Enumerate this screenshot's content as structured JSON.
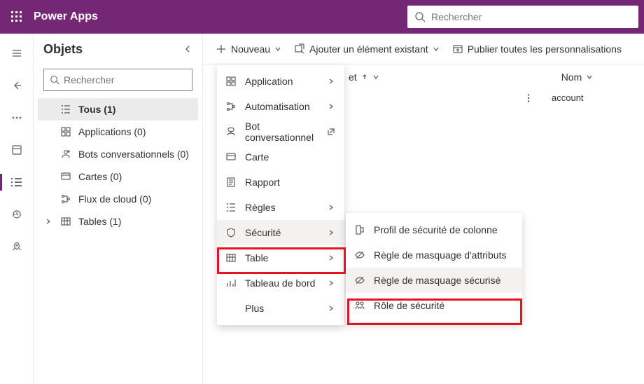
{
  "header": {
    "appTitle": "Power Apps",
    "searchPlaceholder": "Rechercher"
  },
  "sidePanel": {
    "title": "Objets",
    "searchPlaceholder": "Rechercher",
    "items": [
      {
        "label": "Tous  (1)",
        "selected": true,
        "expandable": false
      },
      {
        "label": "Applications  (0)",
        "selected": false,
        "expandable": false
      },
      {
        "label": "Bots conversationnels  (0)",
        "selected": false,
        "expandable": false
      },
      {
        "label": "Cartes  (0)",
        "selected": false,
        "expandable": false
      },
      {
        "label": "Flux de cloud  (0)",
        "selected": false,
        "expandable": false
      },
      {
        "label": "Tables  (1)",
        "selected": false,
        "expandable": true
      }
    ]
  },
  "cmdbar": {
    "new": "Nouveau",
    "addExisting": "Ajouter un élément existant",
    "publish": "Publier toutes les personnalisations"
  },
  "columns": {
    "displayName": "et",
    "name": "Nom"
  },
  "row": {
    "name": "account"
  },
  "newMenu": {
    "items": [
      {
        "label": "Application",
        "hasSub": true
      },
      {
        "label": "Automatisation",
        "hasSub": true
      },
      {
        "label": "Bot conversationnel",
        "external": true
      },
      {
        "label": "Carte"
      },
      {
        "label": "Rapport"
      },
      {
        "label": "Règles",
        "hasSub": true
      },
      {
        "label": "Sécurité",
        "hasSub": true,
        "hovered": true
      },
      {
        "label": "Table",
        "hasSub": true
      },
      {
        "label": "Tableau de bord",
        "hasSub": true
      },
      {
        "label": "Plus",
        "hasSub": true,
        "indent": true
      }
    ]
  },
  "securitySub": {
    "items": [
      {
        "label": "Profil de sécurité de colonne"
      },
      {
        "label": "Règle de masquage d'attributs"
      },
      {
        "label": "Règle de masquage sécurisé",
        "hovered": true
      },
      {
        "label": "Rôle de sécurité"
      }
    ]
  }
}
